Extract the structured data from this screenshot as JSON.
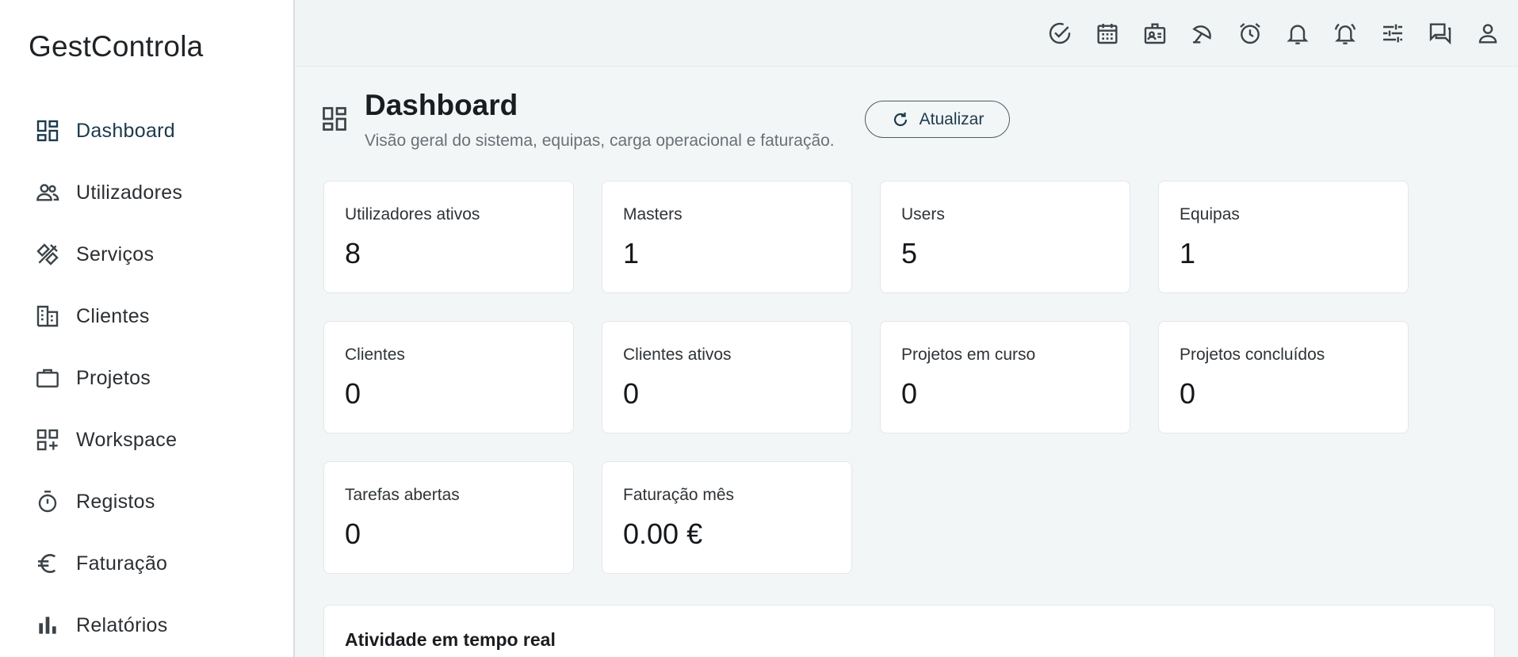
{
  "app": {
    "brand": "GestControla"
  },
  "sidebar": {
    "items": [
      {
        "label": "Dashboard",
        "icon": "dashboard-icon",
        "active": true
      },
      {
        "label": "Utilizadores",
        "icon": "users-icon"
      },
      {
        "label": "Serviços",
        "icon": "tools-icon"
      },
      {
        "label": "Clientes",
        "icon": "building-icon"
      },
      {
        "label": "Projetos",
        "icon": "briefcase-icon"
      },
      {
        "label": "Workspace",
        "icon": "grid-add-icon"
      },
      {
        "label": "Registos",
        "icon": "timer-icon"
      },
      {
        "label": "Faturação",
        "icon": "euro-icon"
      },
      {
        "label": "Relatórios",
        "icon": "bar-chart-icon"
      }
    ]
  },
  "topbar": {
    "icons": [
      "check-circle-icon",
      "calendar-icon",
      "badge-icon",
      "umbrella-icon",
      "alarm-clock-icon",
      "bell-icon",
      "bell-ringing-icon",
      "sliders-icon",
      "chat-icon",
      "user-icon"
    ]
  },
  "header": {
    "title": "Dashboard",
    "subtitle": "Visão geral do sistema, equipas, carga operacional e faturação.",
    "refresh_label": "Atualizar"
  },
  "stats": [
    {
      "label": "Utilizadores ativos",
      "value": "8"
    },
    {
      "label": "Masters",
      "value": "1"
    },
    {
      "label": "Users",
      "value": "5"
    },
    {
      "label": "Equipas",
      "value": "1"
    },
    {
      "label": "Clientes",
      "value": "0"
    },
    {
      "label": "Clientes ativos",
      "value": "0"
    },
    {
      "label": "Projetos em curso",
      "value": "0"
    },
    {
      "label": "Projetos concluídos",
      "value": "0"
    },
    {
      "label": "Tarefas abertas",
      "value": "0"
    },
    {
      "label": "Faturação mês",
      "value": "0.00 €"
    }
  ],
  "activity": {
    "title": "Atividade em tempo real"
  },
  "colors": {
    "accent": "#1c3a4c",
    "background": "#f3f6f7",
    "card": "#ffffff",
    "icon": "#3b4348"
  }
}
